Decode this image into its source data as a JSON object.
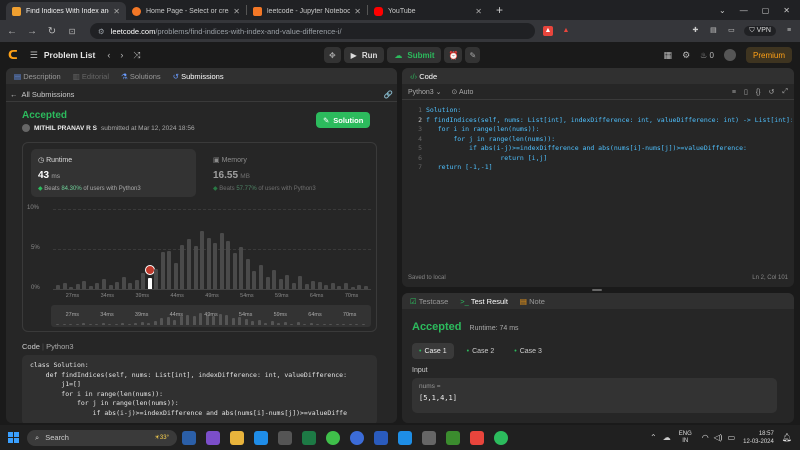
{
  "browser": {
    "tabs": [
      {
        "title": "Find Indices With Index and Valu",
        "color": "#f0a030",
        "active": true
      },
      {
        "title": "Home Page - Select or create a note",
        "color": "#f37726",
        "active": false
      },
      {
        "title": "leetcode - Jupyter Notebook",
        "color": "#f37726",
        "active": false
      },
      {
        "title": "YouTube",
        "color": "#ff0000",
        "active": false
      }
    ],
    "url_host": "leetcode.com",
    "url_path": "/problems/find-indices-with-index-and-value-difference-i/",
    "vpn_label": "VPN"
  },
  "topbar": {
    "problem_list": "Problem List",
    "run": "Run",
    "submit": "Submit",
    "streak": "0",
    "premium": "Premium"
  },
  "left": {
    "tabs": [
      "Description",
      "Editorial",
      "Solutions",
      "Submissions"
    ],
    "back": "All Submissions",
    "status": "Accepted",
    "user": "MITHIL PRANAV R S",
    "submitted": "submitted at Mar 12, 2024 18:56",
    "solution_btn": "Solution",
    "runtime_label": "Runtime",
    "runtime_value": "43",
    "runtime_unit": "ms",
    "runtime_beats_pre": "Beats",
    "runtime_beats_pct": "84.30%",
    "runtime_beats_post": "of users with Python3",
    "memory_label": "Memory",
    "memory_value": "16.55",
    "memory_unit": "MB",
    "memory_beats_pre": "Beats",
    "memory_beats_pct": "57.77%",
    "memory_beats_post": "of users with Python3",
    "code_label": "Code",
    "code_lang": "Python3",
    "code_lines": [
      "class Solution:",
      "    def findIndices(self, nums: List[int], indexDifference: int, valueDifference:",
      "        j1=[]",
      "        for i in range(len(nums)):",
      "            for j in range(len(nums)):",
      "                if abs(i-j)>=indexDifference and abs(nums[i]-nums[j])>=valueDiffe"
    ]
  },
  "chart_data": {
    "type": "bar",
    "yticks": [
      "10%",
      "5%",
      "0%"
    ],
    "ylim": [
      0,
      10
    ],
    "xticks": [
      "27ms",
      "34ms",
      "39ms",
      "44ms",
      "49ms",
      "54ms",
      "59ms",
      "64ms",
      "70ms"
    ],
    "values": [
      0.5,
      0.8,
      0.3,
      0.6,
      1.0,
      0.4,
      0.7,
      1.2,
      0.5,
      0.9,
      1.5,
      0.8,
      1.1,
      2.0,
      1.4,
      2.5,
      4.6,
      4.8,
      3.2,
      5.5,
      6.2,
      5.4,
      7.2,
      6.4,
      5.8,
      7.0,
      6.0,
      4.5,
      5.2,
      3.8,
      2.2,
      3.0,
      1.5,
      2.4,
      1.2,
      1.8,
      0.8,
      1.6,
      0.6,
      1.0,
      0.9,
      0.5,
      0.7,
      0.4,
      0.8,
      0.3,
      0.5,
      0.4
    ],
    "highlight_index": 14,
    "highlight_color": "#ffffff",
    "bar_color": "#4a4a4a"
  },
  "editor": {
    "title": "Code",
    "lang": "Python3",
    "auto": "Auto",
    "lines": [
      "Solution:",
      "f findIndices(self, nums: List[int], indexDifference: int, valueDifference: int) -> List[int]:",
      "   for i in range(len(nums)):",
      "       for j in range(len(nums)):",
      "           if abs(i-j)>=indexDifference and abs(nums[i]-nums[j])>=valueDifference:",
      "                   return [i,j]",
      "   return [-1,-1]"
    ],
    "line_numbers": [
      "1",
      "2",
      "3",
      "4",
      "5",
      "6",
      "7"
    ],
    "saved": "Saved to local",
    "cursor": "Ln 2, Col 101"
  },
  "result": {
    "tabs": [
      "Testcase",
      "Test Result",
      "Note"
    ],
    "status": "Accepted",
    "runtime": "Runtime: 74 ms",
    "cases": [
      "Case 1",
      "Case 2",
      "Case 3"
    ],
    "input_label": "Input",
    "var_name": "nums =",
    "var_value": "[5,1,4,1]"
  },
  "taskbar": {
    "search": "Search",
    "weather": "33°",
    "lang": "ENG",
    "lang2": "IN",
    "time": "18:57",
    "date": "12-03-2024"
  }
}
